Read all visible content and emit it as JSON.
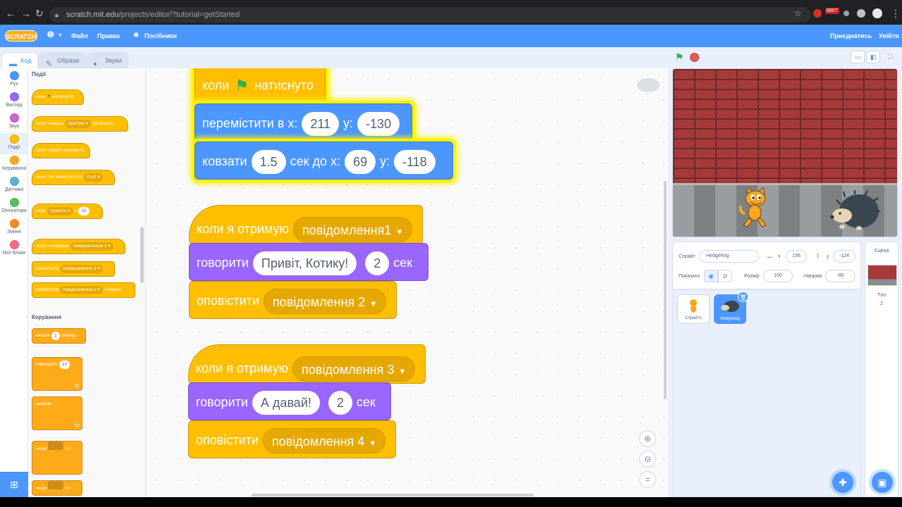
{
  "browser": {
    "url_host": "scratch.mit.edu",
    "url_path": "/projects/editor/?tutorial=getStarted",
    "badge": "8807"
  },
  "menubar": {
    "logo": "SCRATCH",
    "file": "Файл",
    "edit": "Правка",
    "tutorials": "Посібники",
    "join": "Приєднатись",
    "signin": "Увійти"
  },
  "tabs": {
    "code": "Код",
    "costumes": "Образи",
    "sounds": "Звуки"
  },
  "categories": [
    {
      "label": "Рух",
      "color": "#4c97ff"
    },
    {
      "label": "Вигляд",
      "color": "#9966ff"
    },
    {
      "label": "Звук",
      "color": "#cf63cf"
    },
    {
      "label": "Події",
      "color": "#ffbf00"
    },
    {
      "label": "Керування",
      "color": "#ffab19"
    },
    {
      "label": "Датчики",
      "color": "#5cb1d6"
    },
    {
      "label": "Оператори",
      "color": "#59c059"
    },
    {
      "label": "Змінні",
      "color": "#ff8c1a"
    },
    {
      "label": "Мої блоки",
      "color": "#ff6680"
    }
  ],
  "palette": {
    "events_heading": "Події",
    "when": "коли",
    "clicked": "натиснуто",
    "when_key": "коли клавішу",
    "key_space": "пропуск",
    "when_sprite_clicked": "коли спрайт натиснуто",
    "when_backdrop": "коли тло змінеться на",
    "backdrop1": "тло1",
    "loudness": "гучність",
    "gt": ">",
    "ten": "10",
    "when_receive": "коли я отримую",
    "msg2": "повідомлення 2",
    "broadcast": "оповістити",
    "and_wait": "і чекати",
    "control_heading": "Керування",
    "wait": "чекати",
    "one": "1",
    "seconds": "секунд",
    "repeat": "повторити",
    "forever": "завжди",
    "if": "якщо",
    "then": "то"
  },
  "scripts": {
    "s1_when": "коли",
    "s1_clicked": "натиснуто",
    "goto": "перемістити в x:",
    "goto_x": "211",
    "y": "y:",
    "goto_y": "-130",
    "glide": "ковзати",
    "glide_secs": "1.5",
    "glide_to": "сек до x:",
    "glide_x": "69",
    "glide_y": "-118",
    "receive": "коли я отримую",
    "msg1": "повідомлення1",
    "say": "говорити",
    "say1_text": "Привіт, Котику!",
    "say1_secs": "2",
    "sec": "сек",
    "broadcast": "оповістити",
    "bmsg2": "повідомлення 2",
    "msg3": "повідомлення 3",
    "say2_text": "А давай!",
    "say2_secs": "2",
    "bmsg4": "повідомлення 4"
  },
  "sprite_info": {
    "sprite_label": "Спрайт",
    "sprite_name": "Hedgehog",
    "x_label": "x",
    "x_value": "136",
    "y_label": "y",
    "y_value": "-124",
    "show_label": "Показати",
    "size_label": "Розмір",
    "size_value": "100",
    "direction_label": "Напрям",
    "direction_value": "-90"
  },
  "sprites": [
    {
      "name": "Спрайт1"
    },
    {
      "name": "Hedgehog"
    }
  ],
  "stage_pane": {
    "title": "Сцена",
    "backdrop_label": "Тло",
    "backdrop_count": "2"
  }
}
